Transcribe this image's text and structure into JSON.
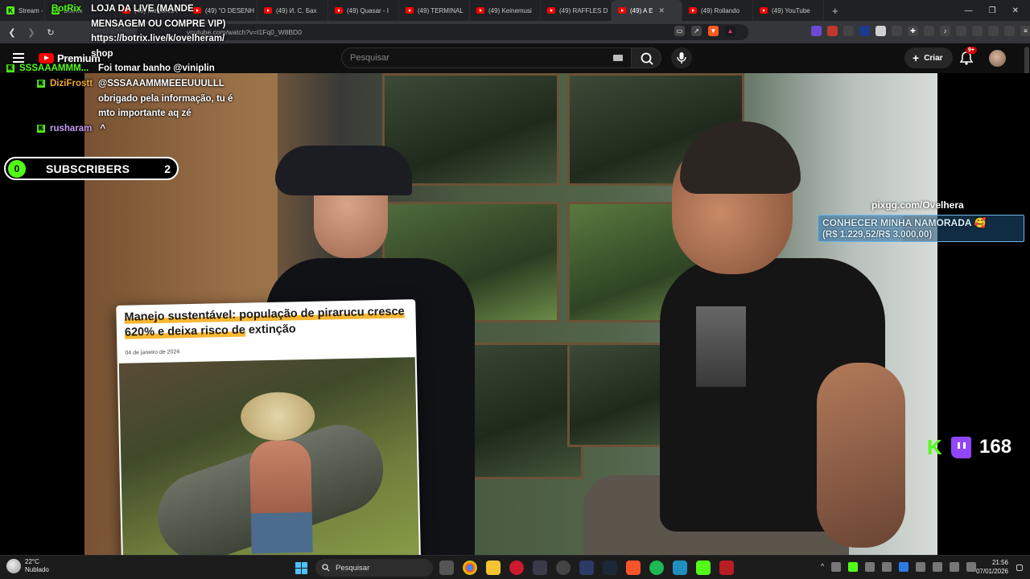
{
  "browser": {
    "tabs": [
      {
        "title": "Stream - ",
        "kind": "kick"
      },
      {
        "title": "BotRix",
        "kind": "kick"
      },
      {
        "title": "(49) Melhores I",
        "kind": "yt"
      },
      {
        "title": "(49) \"O DESENH",
        "kind": "yt"
      },
      {
        "title": "(49) И. С. Бах",
        "kind": "yt"
      },
      {
        "title": "(49) Quasar - I",
        "kind": "yt"
      },
      {
        "title": "(49) TERMINAL",
        "kind": "yt"
      },
      {
        "title": "(49) Keinemusi",
        "kind": "yt"
      },
      {
        "title": "(49) RAFFLES D",
        "kind": "yt"
      },
      {
        "title": "(49) A E",
        "kind": "yt",
        "active": true
      },
      {
        "title": "(49) Rollando",
        "kind": "yt"
      },
      {
        "title": "(49) YouTube",
        "kind": "yt"
      }
    ],
    "url": "youtube.com/watch?v=I1Fq0_W8BD0"
  },
  "youtube": {
    "logo_text": "Premium",
    "search_placeholder": "Pesquisar",
    "create_label": "Criar",
    "notification_badge": "9+"
  },
  "overlay": {
    "chat": [
      {
        "user": "BotRix",
        "user_color": "#53fc18",
        "message": "LOJA DA LIVE (MANDE MENSAGEM OU COMPRE VIP) https://botrix.live/k/ovelheram/ shop"
      },
      {
        "user": "",
        "user_color": "#ffffff",
        "message": "Foi tomar banho @viniplin"
      },
      {
        "user": "SSSAAAMMM...",
        "user_color": "#53fc18",
        "message": ""
      },
      {
        "user": "DiziFrostt",
        "user_color": "#f4a83a",
        "message": "@SSSAAAMMMEEEUUULLL obrigado pela informação, tu é mto importante aq zé"
      },
      {
        "user": "rusharam",
        "user_color": "#c59cf0",
        "message": "^"
      }
    ],
    "subscribers": {
      "label": "SUBSCRIBERS",
      "left_value": "0",
      "right_value": "2"
    },
    "pix": {
      "handle": "pixgg.com/Ovelhera",
      "goal_title": "CONHECER MINHA NAMORADA 🥰",
      "goal_amount": "(R$ 1.229,52/R$ 3.000,00)",
      "goal_progress": 0.41
    },
    "viewers": {
      "count": "168"
    }
  },
  "news_card": {
    "headline_part1": "Manejo sustentável: população de pirarucu cresce",
    "headline_part2": "620% e deixa risco de",
    "headline_part3": "extinção",
    "date": "04 de janeiro de 2024"
  },
  "taskbar": {
    "temperature": "22°C",
    "condition": "Nublado",
    "search_label": "Pesquisar",
    "time": "21:56",
    "date": "07/01/2026"
  },
  "colors": {
    "kick_green": "#53fc18",
    "youtube_red": "#ff0000",
    "twitch_purple": "#9146ff"
  }
}
